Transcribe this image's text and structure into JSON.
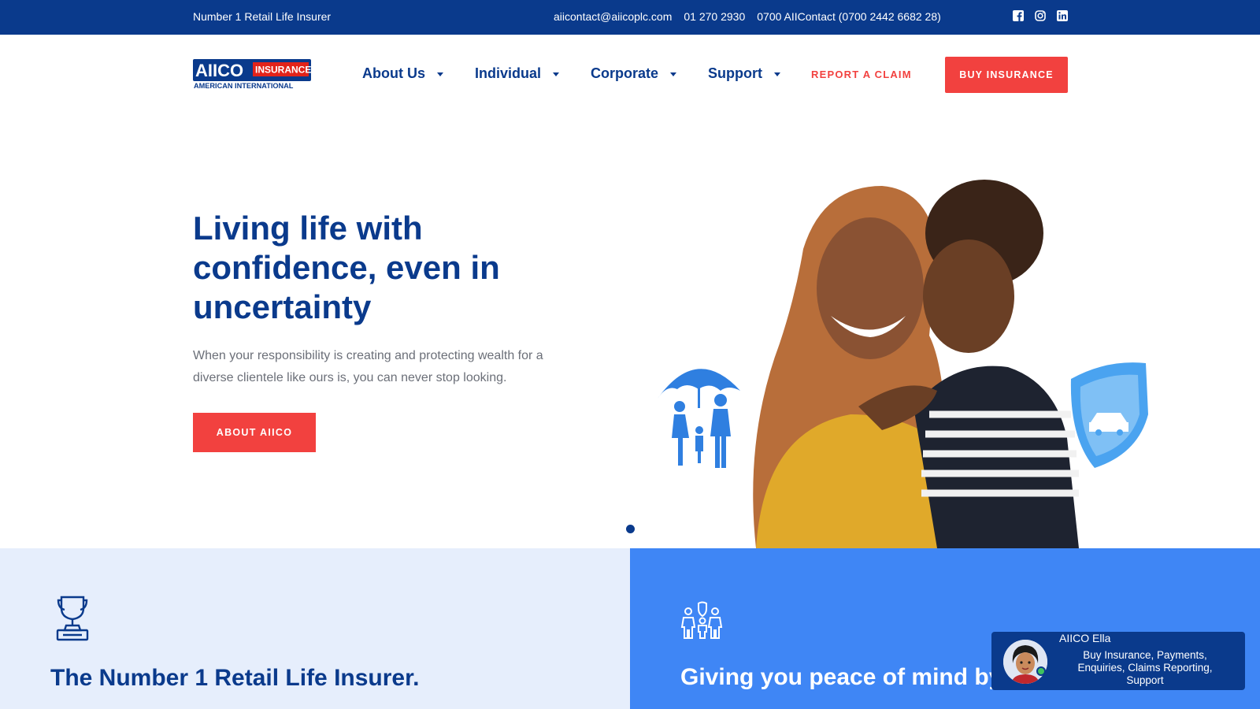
{
  "topbar": {
    "tagline": "Number 1 Retail Life Insurer",
    "email": "aiicontact@aiicoplc.com",
    "phone": "01 270 2930",
    "hotline": "0700 AIIContact (0700 2442 6682 28)",
    "socials": [
      "facebook-icon",
      "instagram-icon",
      "linkedin-icon"
    ]
  },
  "logo": {
    "brand": "AIICO",
    "badge": "INSURANCE",
    "subtitle": "AMERICAN INTERNATIONAL"
  },
  "nav": {
    "items": [
      {
        "label": "About Us"
      },
      {
        "label": "Individual"
      },
      {
        "label": "Corporate"
      },
      {
        "label": "Support"
      }
    ],
    "report_claim": "REPORT A CLAIM",
    "buy_insurance": "BUY INSURANCE"
  },
  "hero": {
    "title": "Living life with confidence, even in uncertainty",
    "subtitle": "When your responsibility is creating and protecting wealth for a diverse clientele like ours is, you can never stop looking.",
    "cta": "ABOUT AIICO",
    "slide_count": 1,
    "active_slide": 1
  },
  "panels": {
    "left_title": "The Number 1 Retail Life Insurer.",
    "right_title": "Giving you peace of mind by keeping promises"
  },
  "chat": {
    "name": "AIICO Ella",
    "description": "Buy Insurance, Payments, Enquiries, Claims Reporting, Support"
  },
  "colors": {
    "primary": "#0a3a8c",
    "accent": "#f2413f",
    "panel_light": "#e6eefc",
    "panel_blue": "#3f86f5"
  }
}
